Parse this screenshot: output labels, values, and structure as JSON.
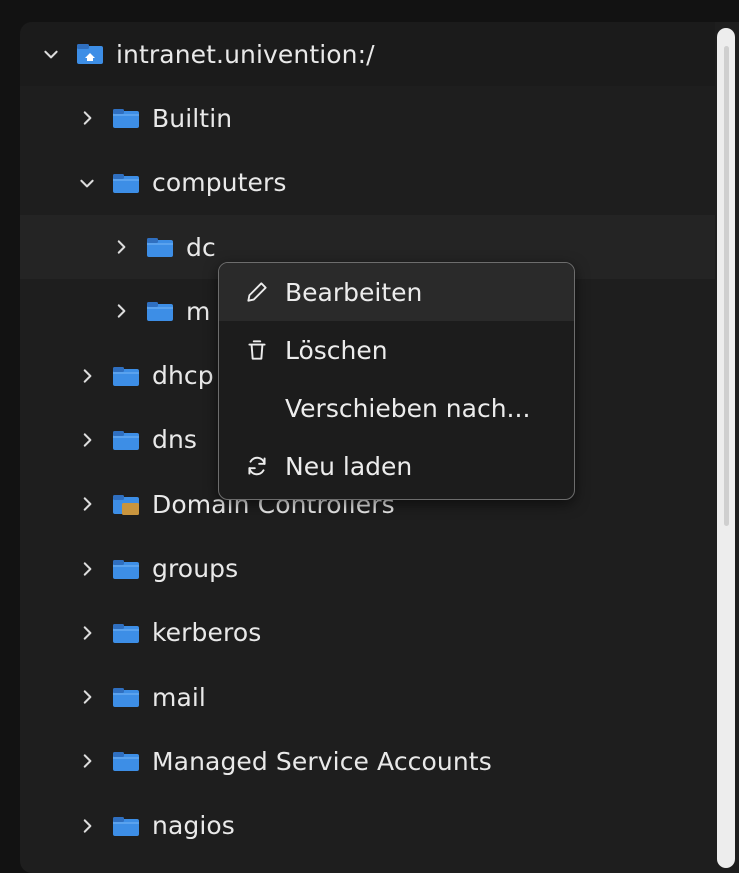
{
  "tree": {
    "root": {
      "label": "intranet.univention:/",
      "icon": "domain-folder-icon",
      "expanded": true
    },
    "items": [
      {
        "label": "Builtin",
        "level": 1,
        "expanded": false,
        "icon": "folder-icon"
      },
      {
        "label": "computers",
        "level": 1,
        "expanded": true,
        "icon": "folder-icon"
      },
      {
        "label": "dc",
        "level": 2,
        "expanded": false,
        "icon": "folder-icon",
        "highlighted": true
      },
      {
        "label": "m",
        "level": 2,
        "expanded": false,
        "icon": "folder-icon"
      },
      {
        "label": "dhcp",
        "level": 1,
        "expanded": false,
        "icon": "folder-icon"
      },
      {
        "label": "dns",
        "level": 1,
        "expanded": false,
        "icon": "folder-icon"
      },
      {
        "label": "Domain Controllers",
        "level": 1,
        "expanded": false,
        "icon": "special-folder-icon"
      },
      {
        "label": "groups",
        "level": 1,
        "expanded": false,
        "icon": "folder-icon"
      },
      {
        "label": "kerberos",
        "level": 1,
        "expanded": false,
        "icon": "folder-icon"
      },
      {
        "label": "mail",
        "level": 1,
        "expanded": false,
        "icon": "folder-icon"
      },
      {
        "label": "Managed Service Accounts",
        "level": 1,
        "expanded": false,
        "icon": "folder-icon"
      },
      {
        "label": "nagios",
        "level": 1,
        "expanded": false,
        "icon": "folder-icon"
      }
    ]
  },
  "context_menu": {
    "items": [
      {
        "label": "Bearbeiten",
        "icon": "pencil-icon",
        "active": true
      },
      {
        "label": "Löschen",
        "icon": "trash-icon",
        "active": false
      },
      {
        "label": "Verschieben nach...",
        "icon": "",
        "active": false
      },
      {
        "label": "Neu laden",
        "icon": "refresh-icon",
        "active": false
      }
    ]
  },
  "colors": {
    "folder_blue": "#3d8ee6",
    "folder_tab": "#2f6fc0",
    "special_folder_accent": "#c9953e",
    "panel_bg": "#1e1e1e",
    "text": "#e9e9e9"
  }
}
